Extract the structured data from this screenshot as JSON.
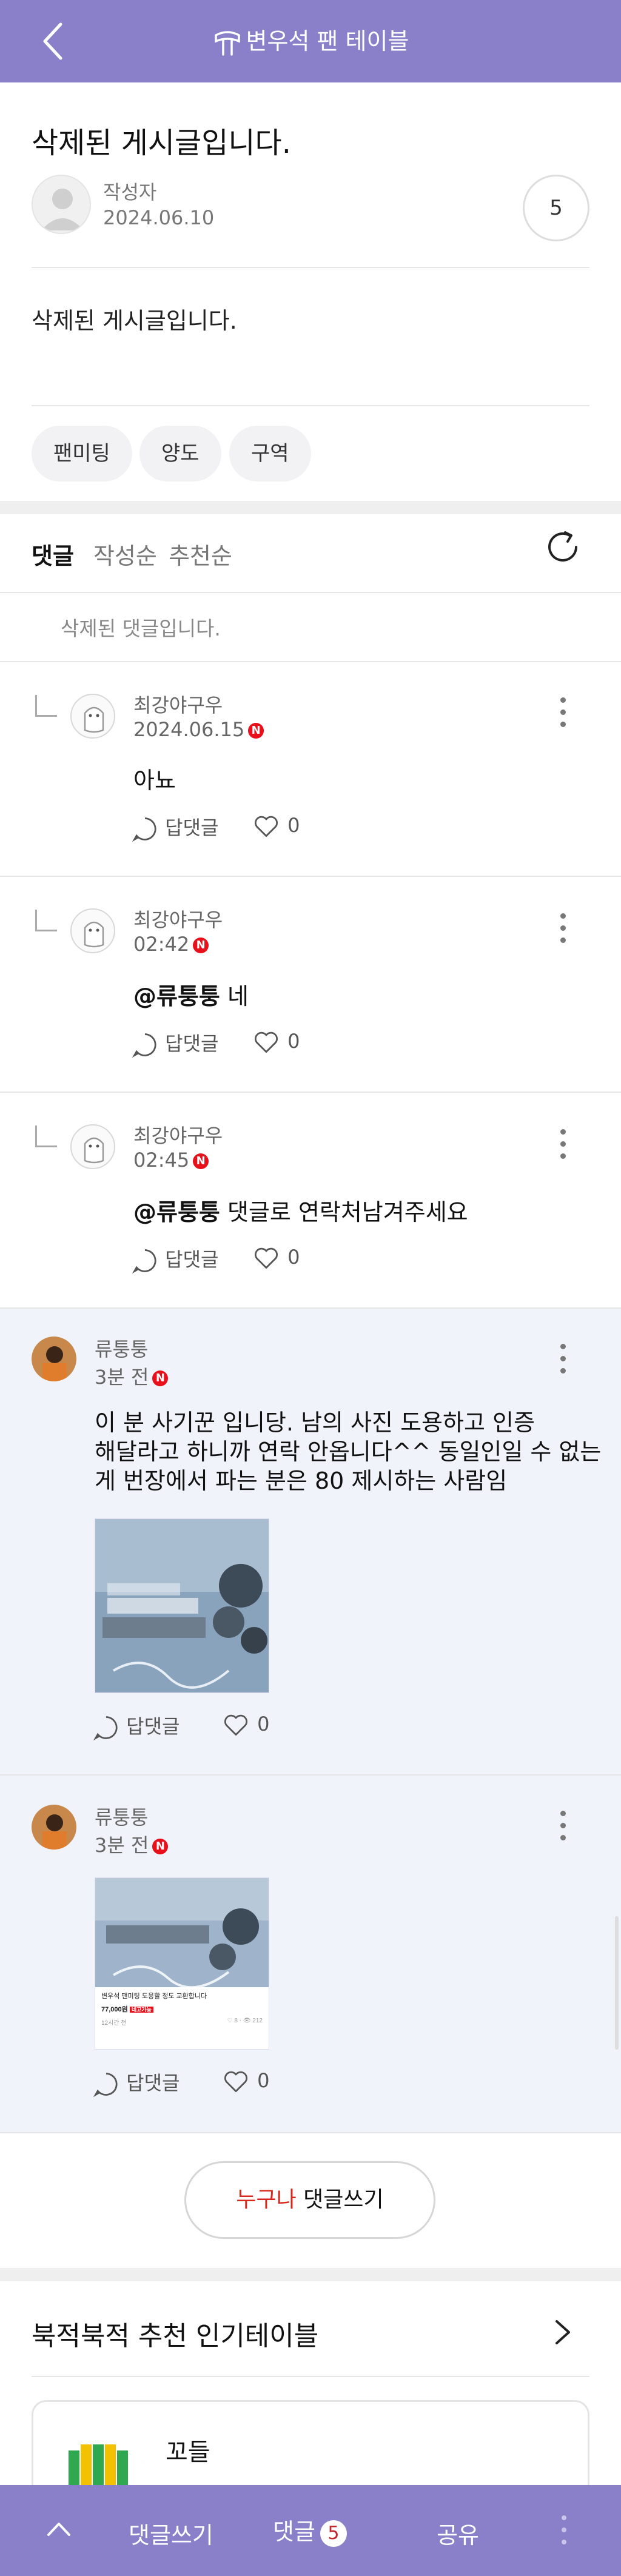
{
  "header": {
    "title": "변우석 팬 테이블",
    "back_icon": "chevron-left-icon",
    "logo_icon": "table-logo-icon"
  },
  "post": {
    "title": "삭제된 게시글입니다.",
    "author": "작성자",
    "date": "2024.06.10",
    "view_count": "5",
    "body": "삭제된 게시글입니다.",
    "tags": [
      "팬미팅",
      "양도",
      "구역"
    ]
  },
  "comments_header": {
    "tabs": [
      "댓글",
      "작성순",
      "추천순"
    ],
    "active_tab": "댓글",
    "refresh_icon": "refresh-icon"
  },
  "deleted_comment": "삭제된 댓글입니다.",
  "replies": [
    {
      "name": "최강야구우",
      "date": "2024.06.15",
      "badge": "N",
      "mention": "",
      "text": "아뇨",
      "reply_label": "답댓글",
      "likes": "0"
    },
    {
      "name": "최강야구우",
      "date": "02:42",
      "badge": "N",
      "mention": "@류퉁퉁",
      "text": " 네",
      "reply_label": "답댓글",
      "likes": "0"
    },
    {
      "name": "최강야구우",
      "date": "02:45",
      "badge": "N",
      "mention": "@류퉁퉁",
      "text": " 댓글로 연락처남겨주세요",
      "reply_label": "답댓글",
      "likes": "0"
    }
  ],
  "top_comments": [
    {
      "name": "류퉁퉁",
      "date": "3분 전",
      "badge": "N",
      "text_lines": [
        "이 분 사기꾼 입니당. 남의 사진 도용하고 인증",
        "해달라고 하니까 연락 안옵니다^^ 동일인일 수 없는",
        "게 번장에서 파는 분은 80 제시하는 사람임"
      ],
      "reply_label": "답댓글",
      "likes": "0"
    },
    {
      "name": "류퉁퉁",
      "date": "3분 전",
      "badge": "N",
      "reply_label": "답댓글",
      "likes": "0",
      "attachment": {
        "caption": "변우석 팬미팅 도용할 정도 교환합니다",
        "price": "77,000원",
        "tag": "네고가능",
        "meta_left": "12시간 전",
        "meta_right": "♡ 8 · 👁 212"
      }
    }
  ],
  "write_button": {
    "accent": "누구나",
    "label": " 댓글쓰기"
  },
  "recommend": {
    "title": "북적북적 추천 인기테이블",
    "card_name": "꼬들"
  },
  "bottom_bar": {
    "write": "댓글쓰기",
    "comments": "댓글",
    "comment_count": "5",
    "share": "공유"
  },
  "colors": {
    "header_bg": "#8a7fc9",
    "badge_red": "#e8101a",
    "accent_red": "#d7281e",
    "comment_bg": "#f0f4fa"
  }
}
